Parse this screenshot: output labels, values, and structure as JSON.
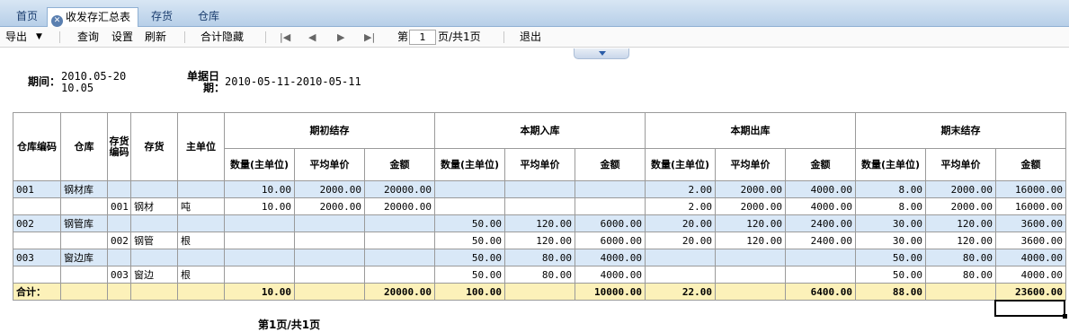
{
  "tabs": [
    {
      "label": "首页"
    },
    {
      "label": "收发存汇总表",
      "active": true
    },
    {
      "label": "存货"
    },
    {
      "label": "仓库"
    }
  ],
  "toolbar": {
    "export": "导出",
    "query": "查询",
    "settings": "设置",
    "refresh": "刷新",
    "hide_totals": "合计隐藏",
    "page_prefix": "第",
    "page_value": "1",
    "page_suffix": "页/共1页",
    "exit": "退出"
  },
  "header": {
    "period_label": "期间：",
    "period_value_line1": "2010.05-20",
    "period_value_line2": "10.05",
    "doc_date_label_line1": "单据日",
    "doc_date_label_line2": "期：",
    "doc_date_value": "2010-05-11-2010-05-11"
  },
  "table": {
    "col_wh_code": "仓库编码",
    "col_wh": "仓库",
    "col_inv_code": "存货编码",
    "col_inv": "存货",
    "col_unit": "主单位",
    "groups": [
      "期初结存",
      "本期入库",
      "本期出库",
      "期末结存"
    ],
    "sub_qty": "数量(主单位)",
    "sub_price": "平均单价",
    "sub_amount": "金额",
    "rows": [
      {
        "type": "grp",
        "wh_code": "001",
        "wh": "钢材库",
        "inv_code": "",
        "inv": "",
        "unit": "",
        "vals": [
          "10.00",
          "2000.00",
          "20000.00",
          "",
          "",
          "",
          "2.00",
          "2000.00",
          "4000.00",
          "8.00",
          "2000.00",
          "16000.00"
        ]
      },
      {
        "type": "item",
        "wh_code": "",
        "wh": "",
        "inv_code": "001",
        "inv": "钢材",
        "unit": "吨",
        "vals": [
          "10.00",
          "2000.00",
          "20000.00",
          "",
          "",
          "",
          "2.00",
          "2000.00",
          "4000.00",
          "8.00",
          "2000.00",
          "16000.00"
        ]
      },
      {
        "type": "grp",
        "wh_code": "002",
        "wh": "钢管库",
        "inv_code": "",
        "inv": "",
        "unit": "",
        "vals": [
          "",
          "",
          "",
          "50.00",
          "120.00",
          "6000.00",
          "20.00",
          "120.00",
          "2400.00",
          "30.00",
          "120.00",
          "3600.00"
        ]
      },
      {
        "type": "item",
        "wh_code": "",
        "wh": "",
        "inv_code": "002",
        "inv": "钢管",
        "unit": "根",
        "vals": [
          "",
          "",
          "",
          "50.00",
          "120.00",
          "6000.00",
          "20.00",
          "120.00",
          "2400.00",
          "30.00",
          "120.00",
          "3600.00"
        ]
      },
      {
        "type": "grp",
        "wh_code": "003",
        "wh": "窗边库",
        "inv_code": "",
        "inv": "",
        "unit": "",
        "vals": [
          "",
          "",
          "",
          "50.00",
          "80.00",
          "4000.00",
          "",
          "",
          "",
          "50.00",
          "80.00",
          "4000.00"
        ]
      },
      {
        "type": "item",
        "wh_code": "",
        "wh": "",
        "inv_code": "003",
        "inv": "窗边",
        "unit": "根",
        "vals": [
          "",
          "",
          "",
          "50.00",
          "80.00",
          "4000.00",
          "",
          "",
          "",
          "50.00",
          "80.00",
          "4000.00"
        ]
      }
    ],
    "total_label": "合计：",
    "totals": [
      "10.00",
      "",
      "20000.00",
      "100.00",
      "",
      "10000.00",
      "22.00",
      "",
      "6400.00",
      "88.00",
      "",
      "23600.00"
    ]
  },
  "footer": {
    "page_text": "第1页/共1页"
  },
  "icons": {
    "first": "first-page-icon",
    "prev": "prev-page-icon",
    "next": "next-page-icon",
    "last": "last-page-icon",
    "dropdown": "chevron-down-icon",
    "close": "close-icon"
  }
}
